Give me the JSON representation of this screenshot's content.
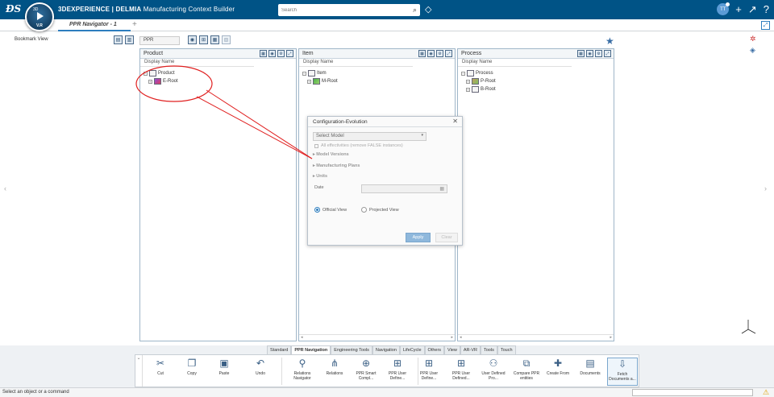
{
  "topbar": {
    "brand": "3DEXPERIENCE | DELMIA",
    "app_name": "Manufacturing Context Builder",
    "compass_top": "3D",
    "compass_version": "V.R",
    "search_placeholder": "Search",
    "avatar_initials": "TT"
  },
  "tabs": {
    "active_tab": "PPR Navigator - 1",
    "add_label": "+"
  },
  "workspace": {
    "bookmark_label": "Bookmark View",
    "ppr_field": "PPR"
  },
  "panels": [
    {
      "title": "Product",
      "column": "Display Name",
      "root": "Product",
      "children": [
        "E-Root"
      ]
    },
    {
      "title": "Item",
      "column": "Display Name",
      "root": "Item",
      "children": [
        "M-Root"
      ]
    },
    {
      "title": "Process",
      "column": "Display Name",
      "root": "Process",
      "children": [
        "P-Root",
        "B-Root"
      ]
    }
  ],
  "dialog": {
    "title": "Configuration-Evolution",
    "select_model_placeholder": "Select Model",
    "effectivities_label": "All effectivities (remove FALSE instances)",
    "sections": [
      "Model Versions",
      "Manufacturing Plans",
      "Units"
    ],
    "date_label": "Date",
    "radio_official": "Official View",
    "radio_projected": "Projected View",
    "apply_label": "Apply",
    "clear_label": "Clear"
  },
  "actionbar": {
    "tabs": [
      "Standard",
      "PPR Navigation",
      "Engineering Tools",
      "Navigation",
      "LifeCycle",
      "Others",
      "View",
      "AR-VR",
      "Tools",
      "Touch"
    ],
    "active_tab_index": 1,
    "commands": [
      {
        "label": "Cut",
        "icon": "scissors-icon"
      },
      {
        "label": "Copy",
        "icon": "copy-icon"
      },
      {
        "label": "Paste",
        "icon": "paste-icon"
      },
      {
        "label": "Undo",
        "icon": "undo-icon"
      },
      {
        "label": "Relations Navigator",
        "icon": "relations-navigator-icon"
      },
      {
        "label": "Relations",
        "icon": "relations-icon"
      },
      {
        "label": "PPR Smart Compl...",
        "icon": "ppr-smart-icon"
      },
      {
        "label": "PPR User Define...",
        "icon": "ppr-user-icon"
      },
      {
        "label": "PPR User Define...",
        "icon": "ppr-user-icon"
      },
      {
        "label": "PPR User Defined...",
        "icon": "ppr-user-icon"
      },
      {
        "label": "User Defined Pro...",
        "icon": "user-defined-icon"
      },
      {
        "label": "Compare PPR entities",
        "icon": "compare-icon"
      },
      {
        "label": "Create From",
        "icon": "create-from-icon"
      },
      {
        "label": "Documents",
        "icon": "documents-icon"
      },
      {
        "label": "Fetch Documents a...",
        "icon": "fetch-documents-icon"
      }
    ]
  },
  "status": {
    "message": "Select an object or a command"
  },
  "colors": {
    "topbar": "#005386",
    "accent": "#2d7dbe",
    "annotation": "#e02020"
  }
}
